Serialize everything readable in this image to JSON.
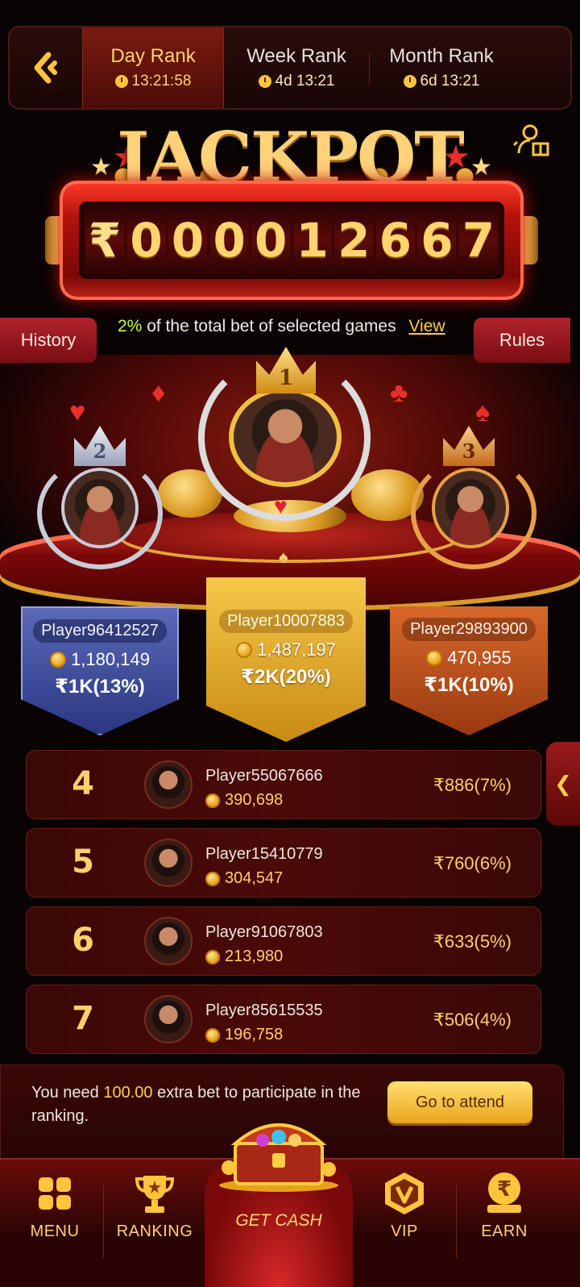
{
  "tabs": [
    {
      "label": "Day Rank",
      "timer": "13:21:58",
      "active": true
    },
    {
      "label": "Week Rank",
      "timer": "4d 13:21",
      "active": false
    },
    {
      "label": "Month Rank",
      "timer": "6d 13:21",
      "active": false
    }
  ],
  "jackpot": {
    "title": "JACKPOT",
    "currency": "₹",
    "digits": [
      "0",
      "0",
      "0",
      "0",
      "1",
      "2",
      "6",
      "6",
      "7"
    ]
  },
  "info": {
    "history_label": "History",
    "rules_label": "Rules",
    "percent": "2%",
    "text": "of the total bet of selected games",
    "view_label": "View"
  },
  "top3": [
    {
      "rank": "1",
      "name": "Player10007883",
      "score": "1,487,197",
      "prize": "₹2K(20%)"
    },
    {
      "rank": "2",
      "name": "Player96412527",
      "score": "1,180,149",
      "prize": "₹1K(13%)"
    },
    {
      "rank": "3",
      "name": "Player29893900",
      "score": "470,955",
      "prize": "₹1K(10%)"
    }
  ],
  "ranking_list": [
    {
      "rank": "4",
      "name": "Player55067666",
      "score": "390,698",
      "prize": "₹886(7%)"
    },
    {
      "rank": "5",
      "name": "Player15410779",
      "score": "304,547",
      "prize": "₹760(6%)"
    },
    {
      "rank": "6",
      "name": "Player91067803",
      "score": "213,980",
      "prize": "₹633(5%)"
    },
    {
      "rank": "7",
      "name": "Player85615535",
      "score": "196,758",
      "prize": "₹506(4%)"
    }
  ],
  "notice": {
    "prefix": "You need",
    "amount": "100.00",
    "suffix": "extra bet to participate in the ranking.",
    "button": "Go to attend"
  },
  "nav": {
    "menu": "MENU",
    "ranking": "RANKING",
    "get_cash": "GET CASH",
    "vip": "VIP",
    "earn": "EARN"
  },
  "icons": {
    "back": "back-chevron-icon",
    "clock": "clock-icon",
    "gift": "user-gift-icon",
    "coin": "coin-icon",
    "collapse": "chevron-left-icon"
  },
  "colors": {
    "gold": "#ffd06a",
    "accent_red": "#b0242a",
    "rank2_blue": "#3a4890",
    "rank1_gold": "#e8b030",
    "rank3_orange": "#c0501e",
    "percent_green": "#c8ff3a"
  }
}
